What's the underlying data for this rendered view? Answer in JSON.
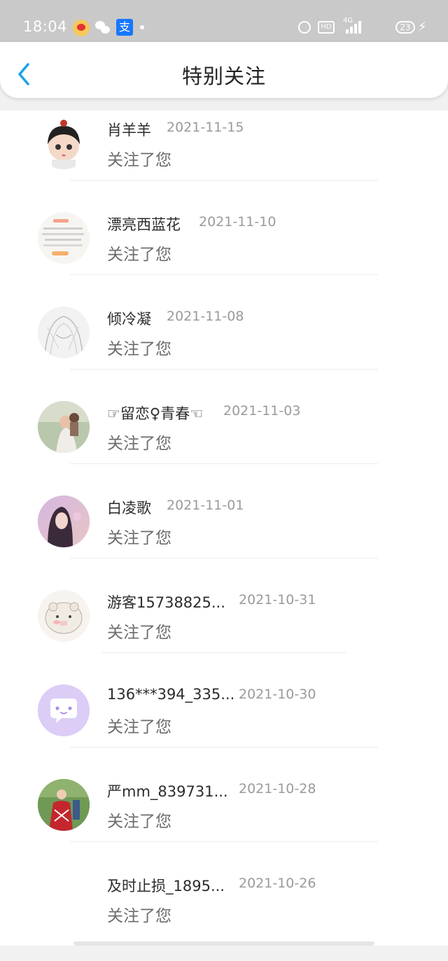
{
  "status_bar": {
    "time": "18:04",
    "alipay_glyph": "支",
    "hd_label": "HD",
    "network_label": "4G",
    "battery_level": "23",
    "icons": [
      "weibo-icon",
      "wechat-icon",
      "alipay-icon",
      "alarm-icon",
      "hd-icon",
      "signal-icon",
      "battery-icon"
    ]
  },
  "header": {
    "title": "特别关注"
  },
  "items": [
    {
      "name": "肖羊羊",
      "date": "2021-11-15",
      "sub": "关注了您"
    },
    {
      "name": "漂亮西蓝花",
      "date": "2021-11-10",
      "sub": "关注了您"
    },
    {
      "name": "倾冷凝",
      "date": "2021-11-08",
      "sub": "关注了您"
    },
    {
      "name": "☞留恋♀青春☜",
      "date": "2021-11-03",
      "sub": "关注了您"
    },
    {
      "name": "白凌歌",
      "date": "2021-11-01",
      "sub": "关注了您"
    },
    {
      "name": "游客15738825...",
      "date": "2021-10-31",
      "sub": "关注了您"
    },
    {
      "name": "136***394_335...",
      "date": "2021-10-30",
      "sub": "关注了您"
    },
    {
      "name": "严mm_839731...",
      "date": "2021-10-28",
      "sub": "关注了您"
    },
    {
      "name": "及时止损_1895...",
      "date": "2021-10-26",
      "sub": "关注了您"
    }
  ],
  "colors": {
    "accent": "#1aa3e8",
    "status_bar": "#c9c9c9",
    "divider": "#ececec"
  }
}
